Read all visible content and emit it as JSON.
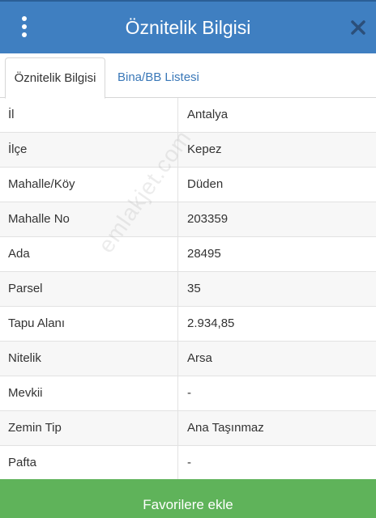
{
  "header": {
    "title": "Öznitelik Bilgisi"
  },
  "tabs": [
    {
      "label": "Öznitelik Bilgisi",
      "active": true
    },
    {
      "label": "Bina/BB Listesi",
      "active": false
    }
  ],
  "rows": [
    {
      "key": "İl",
      "value": "Antalya"
    },
    {
      "key": "İlçe",
      "value": "Kepez"
    },
    {
      "key": "Mahalle/Köy",
      "value": "Düden"
    },
    {
      "key": "Mahalle No",
      "value": "203359"
    },
    {
      "key": "Ada",
      "value": "28495"
    },
    {
      "key": "Parsel",
      "value": "35"
    },
    {
      "key": "Tapu Alanı",
      "value": "2.934,85"
    },
    {
      "key": "Nitelik",
      "value": "Arsa"
    },
    {
      "key": "Mevkii",
      "value": "-"
    },
    {
      "key": "Zemin Tip",
      "value": "Ana Taşınmaz"
    },
    {
      "key": "Pafta",
      "value": "-"
    }
  ],
  "watermark": "emlakjet.com",
  "footer": {
    "favorite_label": "Favorilere ekle"
  },
  "colors": {
    "header_bg": "#3f7fc1",
    "tab_link": "#3a78b8",
    "button_bg": "#5fb35a"
  }
}
